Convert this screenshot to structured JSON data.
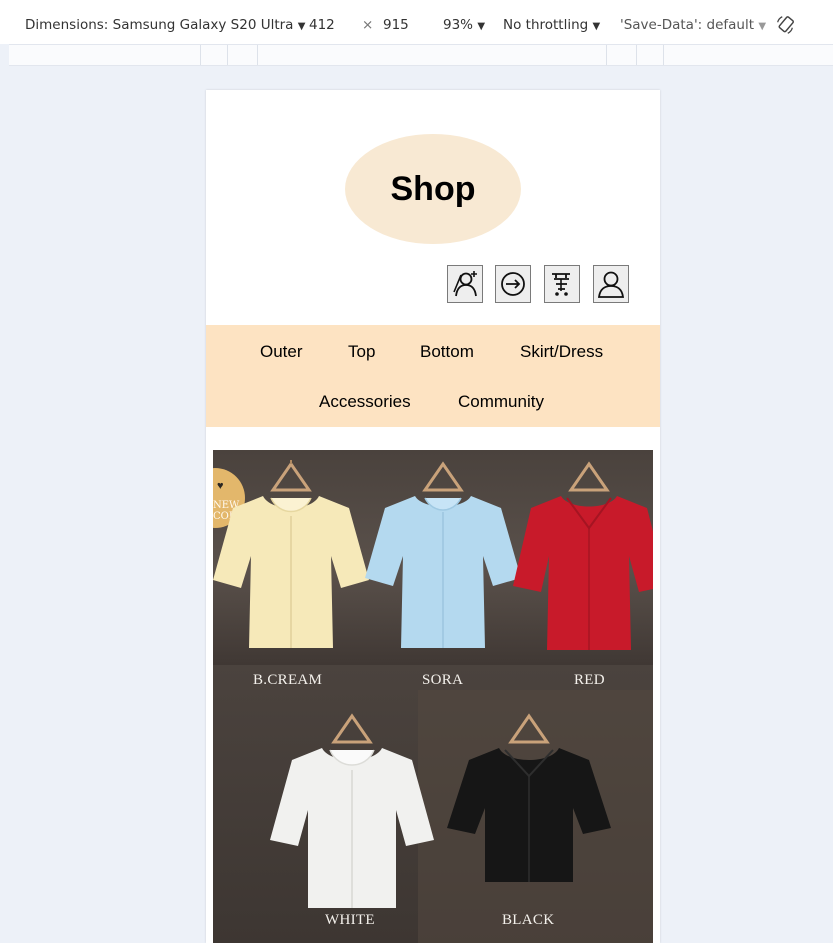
{
  "devtools": {
    "device_label": "Dimensions: Samsung Galaxy S20 Ultra",
    "width": "412",
    "times": "×",
    "height": "915",
    "zoom": "93%",
    "throttling": "No throttling",
    "save_data": "'Save-Data': default",
    "dropdown_arrow": "▼",
    "icons": {
      "rotate": "rotate-icon"
    }
  },
  "site": {
    "logo_text": "Shop",
    "icons": [
      "add-user-icon",
      "login-icon",
      "cart-icon",
      "user-icon"
    ],
    "nav": [
      "Outer",
      "Top",
      "Bottom",
      "Skirt/Dress",
      "Accessories",
      "Community"
    ]
  },
  "banner": {
    "badge_heart": "♥",
    "badge_text": "NEW\nCOLOR",
    "labels": [
      "B.CREAM",
      "SORA",
      "RED",
      "WHITE",
      "BLACK"
    ],
    "colors": {
      "b_cream": "#f6e9b9",
      "sora": "#b4d9ef",
      "red": "#c81a2a",
      "white": "#f1f1ef",
      "black": "#161616",
      "nav_bg": "#fde3c2",
      "logo_bg": "#f8e9d3"
    }
  }
}
